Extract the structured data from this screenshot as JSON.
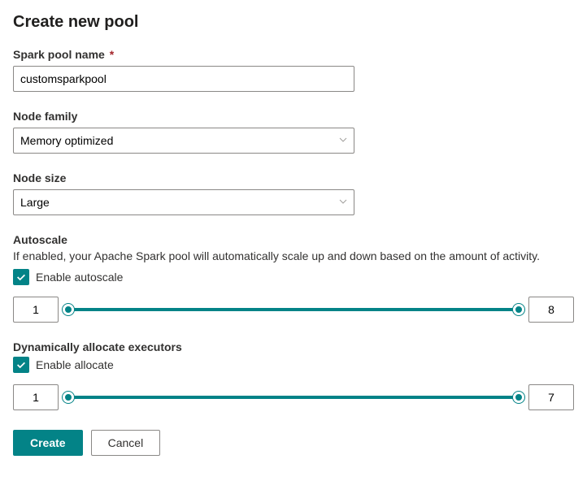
{
  "title": "Create new pool",
  "fields": {
    "poolName": {
      "label": "Spark pool name",
      "required": "*",
      "value": "customsparkpool"
    },
    "nodeFamily": {
      "label": "Node family",
      "value": "Memory optimized"
    },
    "nodeSize": {
      "label": "Node size",
      "value": "Large"
    }
  },
  "autoscale": {
    "label": "Autoscale",
    "description": "If enabled, your Apache Spark pool will automatically scale up and down based on the amount of activity.",
    "checkboxLabel": "Enable autoscale",
    "min": "1",
    "max": "8"
  },
  "dynamicExecutors": {
    "label": "Dynamically allocate executors",
    "checkboxLabel": "Enable allocate",
    "min": "1",
    "max": "7"
  },
  "buttons": {
    "create": "Create",
    "cancel": "Cancel"
  }
}
